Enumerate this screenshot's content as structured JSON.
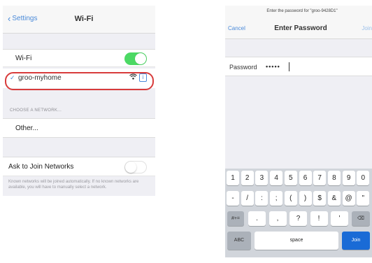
{
  "wifi_screen": {
    "back_label": "Settings",
    "title": "Wi-Fi",
    "wifi_label": "Wi-Fi",
    "wifi_enabled": true,
    "connected_network": "groo-myhome",
    "checkmark": "✓",
    "info_symbol": "i",
    "choose_header": "CHOOSE A NETWORK...",
    "other_label": "Other...",
    "ask_label": "Ask to Join Networks",
    "ask_enabled": false,
    "ask_description": "Known networks will be joined automatically. If no known networks are available, you will have to manually select a network.",
    "highlight_color": "#d83b3b",
    "toggle_on_color": "#4cd964"
  },
  "password_screen": {
    "prompt": "Enter the password for \"groo-9428D1\"",
    "cancel_label": "Cancel",
    "title": "Enter Password",
    "join_label": "Join",
    "password_label": "Password",
    "password_value": "•••••",
    "accent_color": "#4a8ad9"
  },
  "keyboard": {
    "row1": [
      "1",
      "2",
      "3",
      "4",
      "5",
      "6",
      "7",
      "8",
      "9",
      "0"
    ],
    "row2": [
      "-",
      "/",
      ":",
      ";",
      "(",
      ")",
      "$",
      "&",
      "@",
      "\""
    ],
    "row3_left": "#+=",
    "row3": [
      ".",
      ",",
      "?",
      "!",
      "'"
    ],
    "row3_right": "⌫",
    "abc_label": "ABC",
    "space_label": "space",
    "join_label": "Join"
  }
}
